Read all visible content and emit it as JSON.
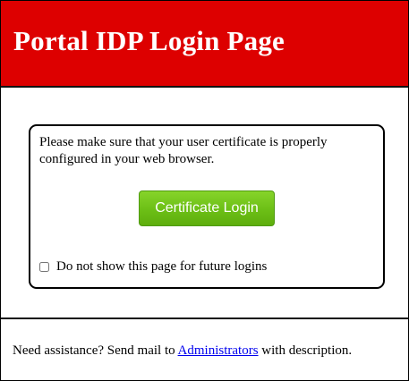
{
  "header": {
    "title": "Portal IDP Login Page"
  },
  "login": {
    "instructions": "Please make sure that your user certificate is properly configured in your web browser.",
    "button_label": "Certificate Login",
    "checkbox_label": "Do not show this page for future logins",
    "checkbox_checked": false
  },
  "footer": {
    "text_before": "Need assistance? Send mail to ",
    "link_text": "Administrators",
    "text_after": " with description."
  },
  "colors": {
    "header_bg": "#dd0000",
    "button_green": "#6cbf16",
    "link_blue": "#0000ee"
  }
}
